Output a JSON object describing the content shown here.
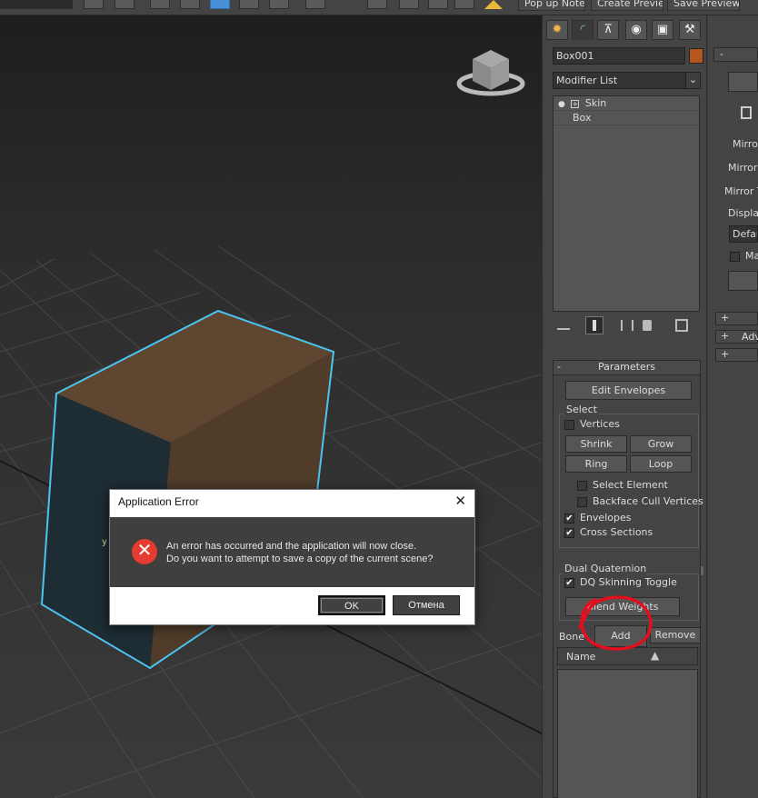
{
  "toolbar": {
    "text_buttons": [
      "Pop up Note",
      "Create Preview",
      "Save Preview"
    ]
  },
  "viewport": {
    "axis_label": "y",
    "viewcube_icon": "viewcube-icon"
  },
  "command_panel": {
    "tabs": [
      {
        "name": "create-tab",
        "glyph": "✹"
      },
      {
        "name": "modify-tab",
        "glyph": "◜"
      },
      {
        "name": "hierarchy-tab",
        "glyph": "⊼"
      },
      {
        "name": "motion-tab",
        "glyph": "◉"
      },
      {
        "name": "display-tab",
        "glyph": "▣"
      },
      {
        "name": "utilities-tab",
        "glyph": "⚒"
      }
    ],
    "object_name": "Box001",
    "object_color": "#b5561d",
    "modifier_list": "Modifier List",
    "stack": [
      {
        "label": "Skin"
      },
      {
        "label": "Box"
      }
    ],
    "parameters": {
      "title": "Parameters",
      "collapse": "-",
      "edit_envelopes": "Edit Envelopes",
      "select_group": "Select",
      "vertices": "Vertices",
      "shrink": "Shrink",
      "grow": "Grow",
      "ring": "Ring",
      "loop": "Loop",
      "select_element": "Select Element",
      "backface_cull": "Backface Cull Vertices",
      "envelopes": "Envelopes",
      "cross_sections": "Cross Sections",
      "dq_group": "Dual Quaternion",
      "dq_toggle": "DQ Skinning Toggle",
      "blend_weights": "Blend Weights",
      "bones_label": "Bone",
      "add": "Add",
      "remove": "Remove",
      "name_header": "Name",
      "check_mark": "✔",
      "sort_arrow": "▲"
    }
  },
  "right_panel": {
    "collapse": "-",
    "mirror_1": "Mirror",
    "mirror_2": "Mirror",
    "mirror_3": "Mirror T",
    "display": "Display",
    "default_dropdown": "Defau",
    "checkbox_label": "Ma",
    "plus": "+",
    "adv": "Adv"
  },
  "dialog": {
    "title": "Application Error",
    "close": "✕",
    "icon": "✕",
    "message_line1": "An error has occurred and the application will now close.",
    "message_line2": "Do you want to attempt to save a copy of the current scene?",
    "ok": "OK",
    "cancel": "Отмена"
  },
  "colors": {
    "annotation": "#e0101e",
    "selection": "#4cc3f0",
    "box_top": "#5e4630",
    "box_front": "#503c29",
    "box_side": "#1e2c33"
  }
}
